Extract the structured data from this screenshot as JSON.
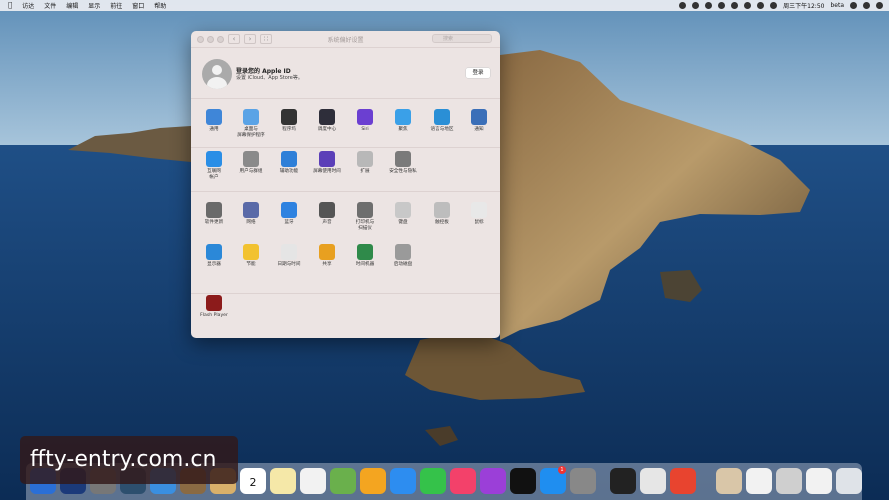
{
  "menubar": {
    "items": [
      "访达",
      "文件",
      "编辑",
      "显示",
      "前往",
      "窗口",
      "帮助"
    ],
    "status": {
      "clock": "周三下午12:50",
      "user": "beta"
    }
  },
  "window": {
    "title": "系统偏好设置",
    "search_placeholder": "搜索",
    "account": {
      "title": "登录您的 Apple ID",
      "subtitle": "设置 iCloud、App Store等。",
      "login_button": "登录"
    },
    "row1": [
      {
        "label": "通用",
        "icon": "general-icon",
        "color": "#3f86d8"
      },
      {
        "label": "桌面与\n屏幕保护程序",
        "icon": "desktop-icon",
        "color": "#5aa3e6"
      },
      {
        "label": "程序坞",
        "icon": "dock-icon",
        "color": "#333333"
      },
      {
        "label": "调度中心",
        "icon": "mission-control-icon",
        "color": "#2e2e3a"
      },
      {
        "label": "Siri",
        "icon": "siri-icon",
        "color": "#6b3fd1"
      },
      {
        "label": "聚焦",
        "icon": "spotlight-icon",
        "color": "#3aa0e8"
      },
      {
        "label": "语言与地区",
        "icon": "language-icon",
        "color": "#2a8fd6"
      },
      {
        "label": "通知",
        "icon": "notifications-icon",
        "color": "#3b6fb8"
      }
    ],
    "row2": [
      {
        "label": "互联网\n帐户",
        "icon": "internet-accounts-icon",
        "color": "#2a8ee6"
      },
      {
        "label": "用户与群组",
        "icon": "users-icon",
        "color": "#8a8a8a"
      },
      {
        "label": "辅助功能",
        "icon": "accessibility-icon",
        "color": "#2e7fd8"
      },
      {
        "label": "屏幕使用时间",
        "icon": "screen-time-icon",
        "color": "#5b3fb8"
      },
      {
        "label": "扩展",
        "icon": "extensions-icon",
        "color": "#b8b8b8"
      },
      {
        "label": "安全性与隐私",
        "icon": "security-icon",
        "color": "#7a7a7a"
      }
    ],
    "row3": [
      {
        "label": "软件更新",
        "icon": "software-update-icon",
        "color": "#6a6a6a"
      },
      {
        "label": "网络",
        "icon": "network-icon",
        "color": "#5a6aa8"
      },
      {
        "label": "蓝牙",
        "icon": "bluetooth-icon",
        "color": "#2e82e0"
      },
      {
        "label": "声音",
        "icon": "sound-icon",
        "color": "#555555"
      },
      {
        "label": "打印机与\n扫描仪",
        "icon": "printers-icon",
        "color": "#6e6e6e"
      },
      {
        "label": "键盘",
        "icon": "keyboard-icon",
        "color": "#c8c8c8"
      },
      {
        "label": "触控板",
        "icon": "trackpad-icon",
        "color": "#bdbdbd"
      },
      {
        "label": "鼠标",
        "icon": "mouse-icon",
        "color": "#e8e8e8"
      }
    ],
    "row4": [
      {
        "label": "显示器",
        "icon": "displays-icon",
        "color": "#2b88d8"
      },
      {
        "label": "节能",
        "icon": "energy-saver-icon",
        "color": "#f2c230"
      },
      {
        "label": "日期与时间",
        "icon": "date-time-icon",
        "color": "#e5e5e5"
      },
      {
        "label": "共享",
        "icon": "sharing-icon",
        "color": "#e8a020"
      },
      {
        "label": "时间机器",
        "icon": "time-machine-icon",
        "color": "#2f8a4a"
      },
      {
        "label": "启动磁盘",
        "icon": "startup-disk-icon",
        "color": "#9a9a9a"
      }
    ],
    "row5": [
      {
        "label": "Flash Player",
        "icon": "flash-player-icon",
        "color": "#8c1b1b"
      }
    ]
  },
  "dock": {
    "calendar_day": "2",
    "badge": "1"
  },
  "watermark": "ffty-entry.com.cn"
}
